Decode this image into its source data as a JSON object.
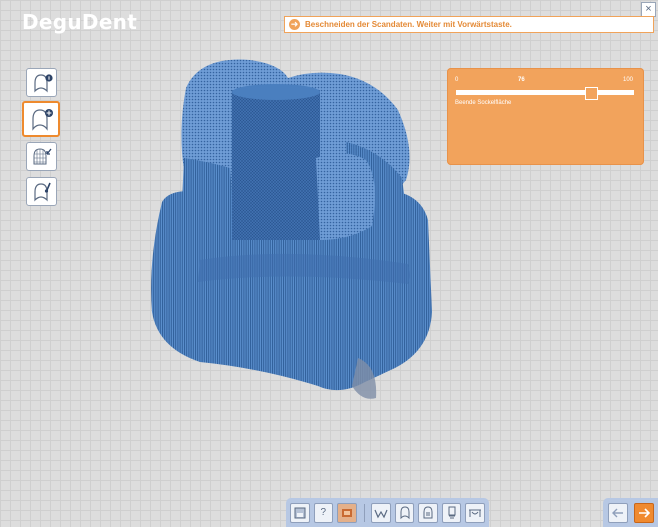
{
  "app": {
    "logo": "DeguDent",
    "close_glyph": "×"
  },
  "instruction": {
    "text": "Beschneiden der Scandaten. Weiter mit Vorwärtstaste."
  },
  "sidebar": {
    "tools": [
      {
        "name": "tooth-info-icon"
      },
      {
        "name": "tooth-add-icon",
        "active": true
      },
      {
        "name": "mesh-arrow-icon"
      },
      {
        "name": "tooth-brush-icon"
      }
    ]
  },
  "panel": {
    "slider_min": "0",
    "slider_value": "76",
    "slider_max": "100",
    "value": 0.76,
    "caption": "Beende Sockelfläche"
  },
  "toolbar": {
    "help_glyph": "?"
  },
  "colors": {
    "accent_orange": "#f2a35c",
    "model_blue": "#4a7fbf",
    "toolbar_blue": "#b7c8e4"
  }
}
